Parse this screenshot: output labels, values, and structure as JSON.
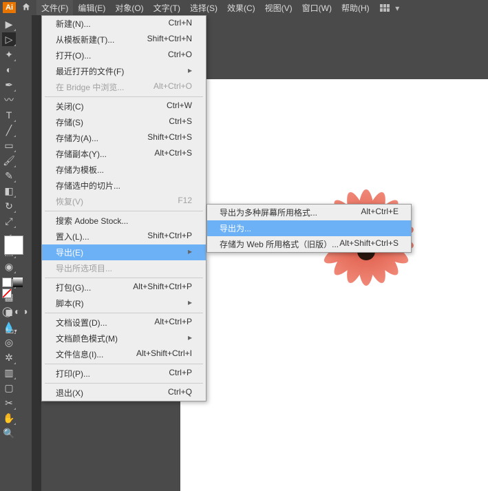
{
  "menubar": {
    "logo": "Ai",
    "items": [
      "文件(F)",
      "编辑(E)",
      "对象(O)",
      "文字(T)",
      "选择(S)",
      "效果(C)",
      "视图(V)",
      "窗口(W)",
      "帮助(H)"
    ]
  },
  "dropdown": {
    "items": [
      {
        "label": "新建(N)...",
        "shortcut": "Ctrl+N",
        "arrow": false
      },
      {
        "label": "从模板新建(T)...",
        "shortcut": "Shift+Ctrl+N",
        "arrow": false
      },
      {
        "label": "打开(O)...",
        "shortcut": "Ctrl+O",
        "arrow": false
      },
      {
        "label": "最近打开的文件(F)",
        "shortcut": "",
        "arrow": true
      },
      {
        "label": "在 Bridge 中浏览...",
        "shortcut": "Alt+Ctrl+O",
        "arrow": false,
        "disabled": true
      },
      {
        "sep": true
      },
      {
        "label": "关闭(C)",
        "shortcut": "Ctrl+W",
        "arrow": false
      },
      {
        "label": "存储(S)",
        "shortcut": "Ctrl+S",
        "arrow": false
      },
      {
        "label": "存储为(A)...",
        "shortcut": "Shift+Ctrl+S",
        "arrow": false
      },
      {
        "label": "存储副本(Y)...",
        "shortcut": "Alt+Ctrl+S",
        "arrow": false
      },
      {
        "label": "存储为模板...",
        "shortcut": "",
        "arrow": false
      },
      {
        "label": "存储选中的切片...",
        "shortcut": "",
        "arrow": false
      },
      {
        "label": "恢复(V)",
        "shortcut": "F12",
        "arrow": false,
        "disabled": true
      },
      {
        "sep": true
      },
      {
        "label": "搜索 Adobe Stock...",
        "shortcut": "",
        "arrow": false
      },
      {
        "label": "置入(L)...",
        "shortcut": "Shift+Ctrl+P",
        "arrow": false
      },
      {
        "label": "导出(E)",
        "shortcut": "",
        "arrow": true,
        "highlighted": true
      },
      {
        "label": "导出所选项目...",
        "shortcut": "",
        "arrow": false,
        "disabled": true
      },
      {
        "sep": true
      },
      {
        "label": "打包(G)...",
        "shortcut": "Alt+Shift+Ctrl+P",
        "arrow": false
      },
      {
        "label": "脚本(R)",
        "shortcut": "",
        "arrow": true
      },
      {
        "sep": true
      },
      {
        "label": "文档设置(D)...",
        "shortcut": "Alt+Ctrl+P",
        "arrow": false
      },
      {
        "label": "文档颜色模式(M)",
        "shortcut": "",
        "arrow": true
      },
      {
        "label": "文件信息(I)...",
        "shortcut": "Alt+Shift+Ctrl+I",
        "arrow": false
      },
      {
        "sep": true
      },
      {
        "label": "打印(P)...",
        "shortcut": "Ctrl+P",
        "arrow": false
      },
      {
        "sep": true
      },
      {
        "label": "退出(X)",
        "shortcut": "Ctrl+Q",
        "arrow": false
      }
    ]
  },
  "submenu": {
    "items": [
      {
        "label": "导出为多种屏幕所用格式...",
        "shortcut": "Alt+Ctrl+E"
      },
      {
        "label": "导出为...",
        "shortcut": "",
        "highlighted": true
      },
      {
        "label": "存储为 Web 所用格式（旧版）...",
        "shortcut": "Alt+Shift+Ctrl+S"
      }
    ]
  }
}
